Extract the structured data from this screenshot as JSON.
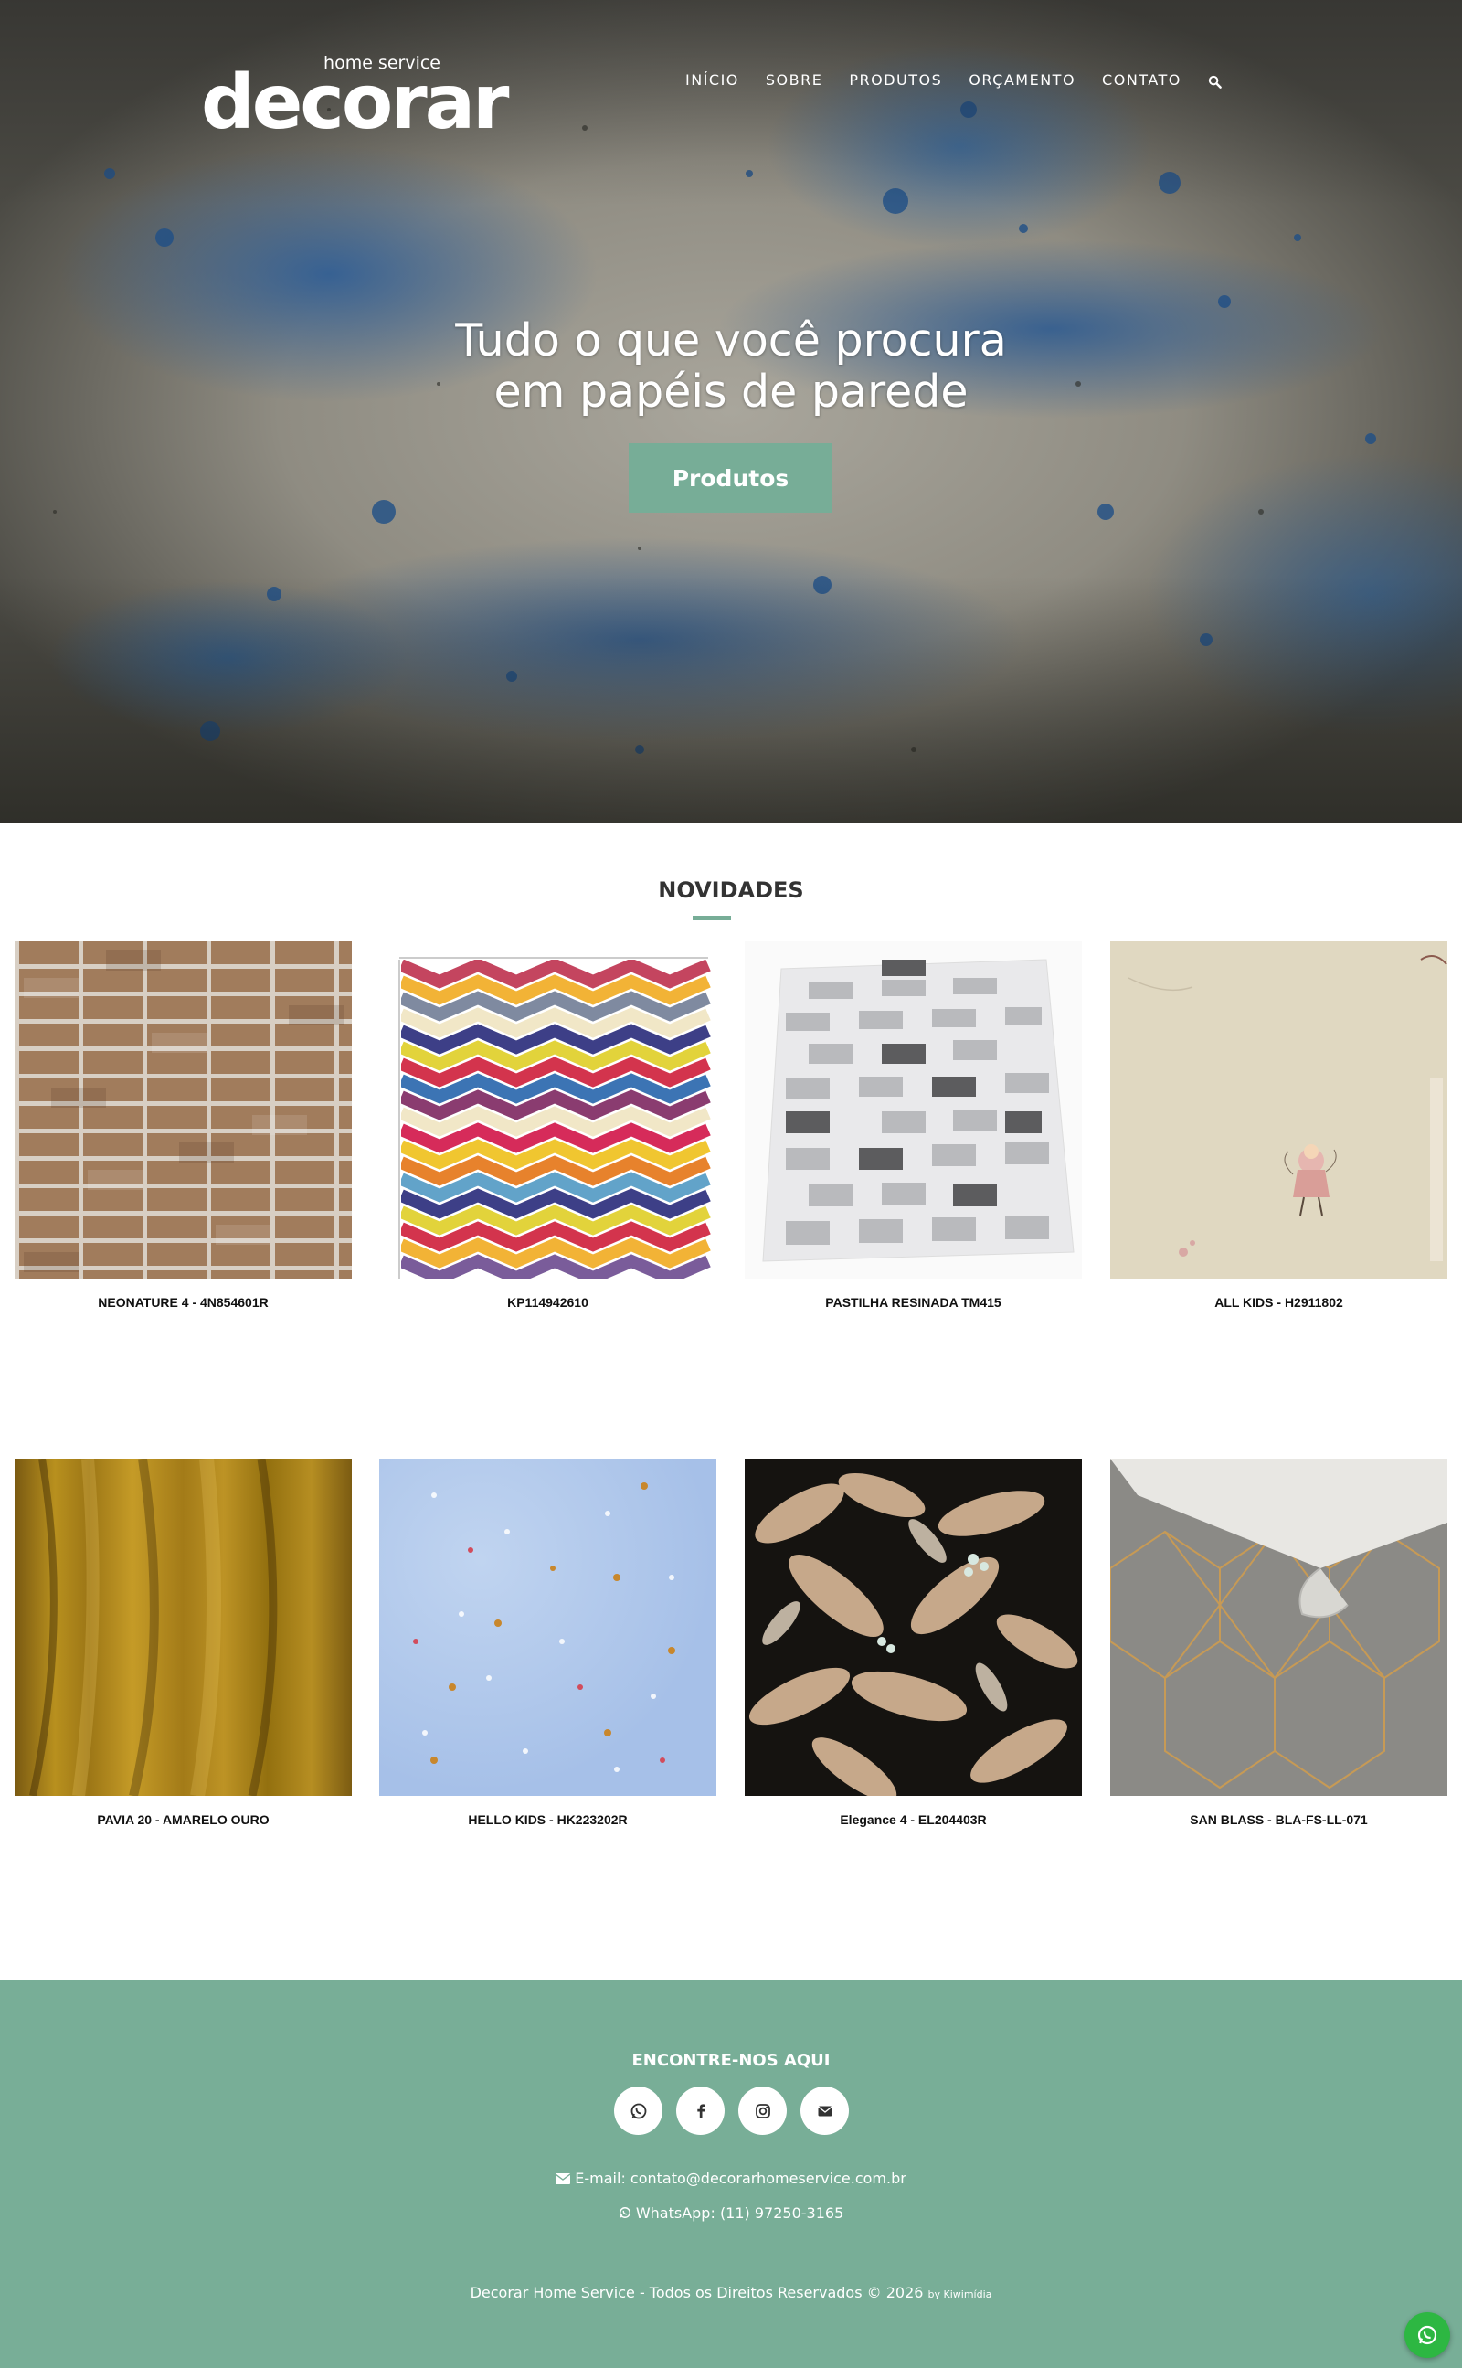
{
  "brand": {
    "logo_main": "decorar",
    "logo_sub": "home service"
  },
  "nav": {
    "items": [
      {
        "label": "INÍCIO"
      },
      {
        "label": "SOBRE"
      },
      {
        "label": "PRODUTOS"
      },
      {
        "label": "ORÇAMENTO"
      },
      {
        "label": "CONTATO"
      }
    ],
    "search_icon": "search-icon"
  },
  "hero": {
    "title_line1": "Tudo o que você procura",
    "title_line2": "em papéis de parede",
    "button_label": "Produtos",
    "accent_color": "#77ad97"
  },
  "novidades": {
    "title": "NOVIDADES",
    "products": [
      {
        "name": "NEONATURE 4 - 4N854601R"
      },
      {
        "name": "KP114942610"
      },
      {
        "name": "PASTILHA RESINADA TM415"
      },
      {
        "name": "ALL KIDS - H2911802"
      },
      {
        "name": "PAVIA 20 - AMARELO OURO"
      },
      {
        "name": "HELLO KIDS - HK223202R"
      },
      {
        "name": "Elegance 4 - EL204403R"
      },
      {
        "name": "SAN BLASS - BLA-FS-LL-071"
      }
    ]
  },
  "footer": {
    "title": "ENCONTRE-NOS AQUI",
    "social_icons": [
      "whatsapp-icon",
      "facebook-icon",
      "instagram-icon",
      "envelope-icon"
    ],
    "email_line": "E-mail: contato@decorarhomeservice.com.br",
    "whatsapp_line": "WhatsApp: (11) 97250-3165",
    "copyright": "Decorar Home Service - Todos os Direitos Reservados © 2026",
    "credit": "by Kiwimídia",
    "background_color": "#78ae97"
  },
  "floating": {
    "whatsapp_icon": "whatsapp-icon",
    "color": "#2db742"
  }
}
